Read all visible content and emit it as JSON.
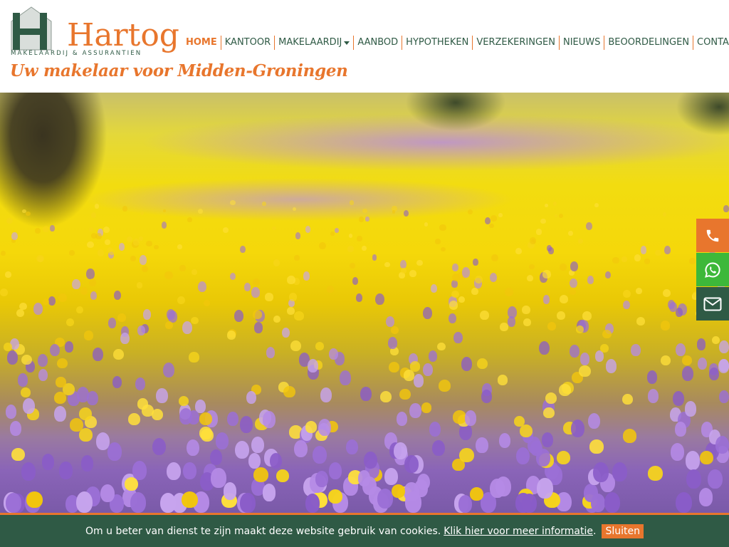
{
  "brand": {
    "name": "Hartog",
    "subtitle": "MAKELAARDIJ & ASSURANTIEN",
    "tagline": "Uw makelaar voor Midden-Groningen",
    "colors": {
      "orange": "#e8762d",
      "green": "#2f5a45",
      "whatsapp": "#3db83a"
    }
  },
  "nav": {
    "items": [
      {
        "label": "HOME",
        "active": true
      },
      {
        "label": "KANTOOR"
      },
      {
        "label": "MAKELAARDIJ",
        "has_dropdown": true
      },
      {
        "label": "AANBOD"
      },
      {
        "label": "HYPOTHEKEN"
      },
      {
        "label": "VERZEKERINGEN"
      },
      {
        "label": "NIEUWS"
      },
      {
        "label": "BEOORDELINGEN"
      },
      {
        "label": "CONTACT"
      }
    ]
  },
  "side_contact": {
    "items": [
      {
        "icon": "phone-icon"
      },
      {
        "icon": "whatsapp-icon"
      },
      {
        "icon": "mail-icon"
      }
    ]
  },
  "cookie": {
    "text": "Om u beter van dienst te zijn maakt deze website gebruik van cookies.",
    "link_text": "Klik hier voor meer informatie",
    "after_link": ".",
    "button_label": "Sluiten"
  }
}
